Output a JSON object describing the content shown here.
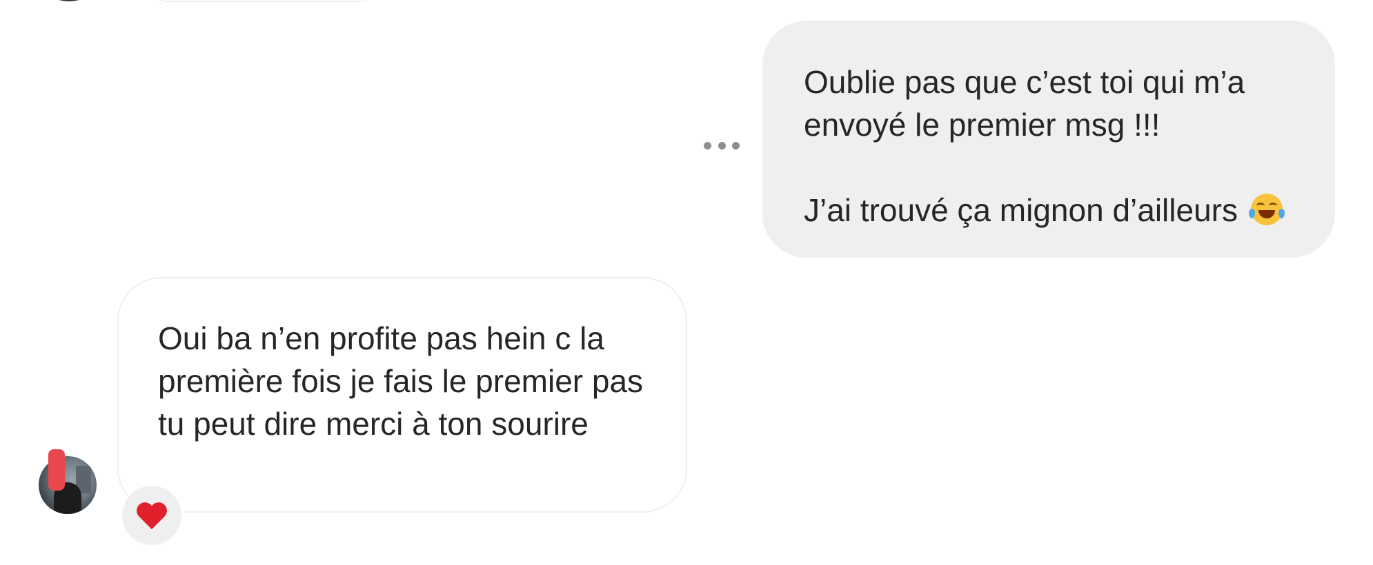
{
  "conversation": {
    "messages": [
      {
        "direction": "sent",
        "paragraphs": [
          "Oublie pas que c’est toi qui m’a envoyé le premier msg !!!",
          "J’ai trouvé ça mignon d’ailleurs"
        ],
        "trailing_emoji": "face-with-tears-of-joy-icon"
      },
      {
        "direction": "received",
        "text": "Oui ba n’en profite pas hein c la première fois je fais le premier pas tu peut dire merci à ton sourire",
        "reaction": "red-heart-icon"
      }
    ],
    "more_options_icon": "more-options-icon"
  },
  "colors": {
    "sent_bubble_bg": "#efefef",
    "received_bubble_border": "#efefef",
    "text": "#262626",
    "heart": "#e0202a",
    "dots": "#8e8e8e"
  }
}
